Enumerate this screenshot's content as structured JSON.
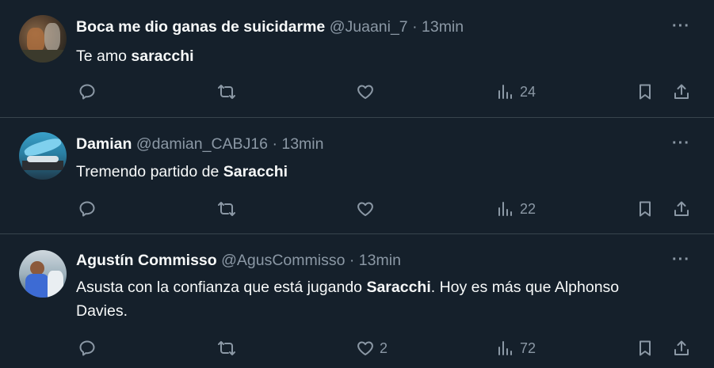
{
  "colors": {
    "background": "#15202b",
    "text": "#f7f9f9",
    "muted": "#8b98a5",
    "divider": "#38444d"
  },
  "tweets": [
    {
      "name": "Boca me dio ganas de suicidarme",
      "handle": "@Juaani_7",
      "separator": "·",
      "time": "13min",
      "text_plain": "Te amo ",
      "text_bold": "saracchi",
      "text_after": "",
      "more": "···",
      "likes": "",
      "views": "24"
    },
    {
      "name": "Damian",
      "handle": "@damian_CABJ16",
      "separator": "·",
      "time": "13min",
      "text_plain": "Tremendo partido de ",
      "text_bold": "Saracchi",
      "text_after": "",
      "more": "···",
      "likes": "",
      "views": "22"
    },
    {
      "name": "Agustín Commisso",
      "handle": "@AgusCommisso",
      "separator": "·",
      "time": "13min",
      "text_plain": "Asusta con la confianza que está jugando ",
      "text_bold": "Saracchi",
      "text_after": ". Hoy es más que Alphonso Davies.",
      "more": "···",
      "likes": "2",
      "views": "72"
    }
  ],
  "icons": {
    "reply": "reply-icon",
    "retweet": "retweet-icon",
    "like": "heart-icon",
    "views": "views-icon",
    "bookmark": "bookmark-icon",
    "share": "share-icon",
    "more": "more-icon"
  }
}
